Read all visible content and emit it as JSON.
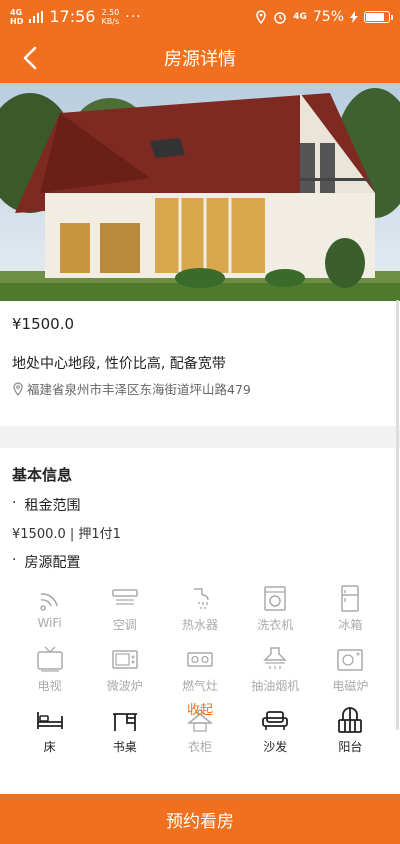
{
  "status": {
    "network": "4G",
    "network_sub": "HD",
    "time": "17:56",
    "speed_value": "2.50",
    "speed_unit": "KB/s",
    "more": "···",
    "right_net": "4G",
    "battery": "75%",
    "battery_level": 0.75
  },
  "header": {
    "title": "房源详情"
  },
  "listing": {
    "price": "¥1500.0",
    "description": "地处中心地段, 性价比高, 配备宽带",
    "address": "福建省泉州市丰泽区东海街道坪山路479"
  },
  "basic": {
    "title": "基本信息",
    "rent_range_label": "租金范围",
    "rent_value": "¥1500.0 | 押1付1",
    "config_label": "房源配置",
    "amenities": [
      {
        "label": "WiFi",
        "icon": "wifi-icon",
        "available": false
      },
      {
        "label": "空调",
        "icon": "air-conditioner-icon",
        "available": false
      },
      {
        "label": "热水器",
        "icon": "water-heater-icon",
        "available": false
      },
      {
        "label": "洗衣机",
        "icon": "washing-machine-icon",
        "available": false
      },
      {
        "label": "冰箱",
        "icon": "fridge-icon",
        "available": false
      },
      {
        "label": "电视",
        "icon": "tv-icon",
        "available": false
      },
      {
        "label": "微波炉",
        "icon": "microwave-icon",
        "available": false
      },
      {
        "label": "燃气灶",
        "icon": "gas-stove-icon",
        "available": false
      },
      {
        "label": "抽油烟机",
        "icon": "range-hood-icon",
        "available": false
      },
      {
        "label": "电磁炉",
        "icon": "induction-cooker-icon",
        "available": false
      },
      {
        "label": "床",
        "icon": "bed-icon",
        "available": true
      },
      {
        "label": "书桌",
        "icon": "desk-icon",
        "available": true
      },
      {
        "label": "衣柜",
        "icon": "wardrobe-icon",
        "available": false
      },
      {
        "label": "沙发",
        "icon": "sofa-icon",
        "available": true
      },
      {
        "label": "阳台",
        "icon": "balcony-icon",
        "available": true
      }
    ],
    "collapse_label": "收起"
  },
  "action": {
    "book_label": "预约看房"
  },
  "colors": {
    "accent": "#f07020"
  }
}
